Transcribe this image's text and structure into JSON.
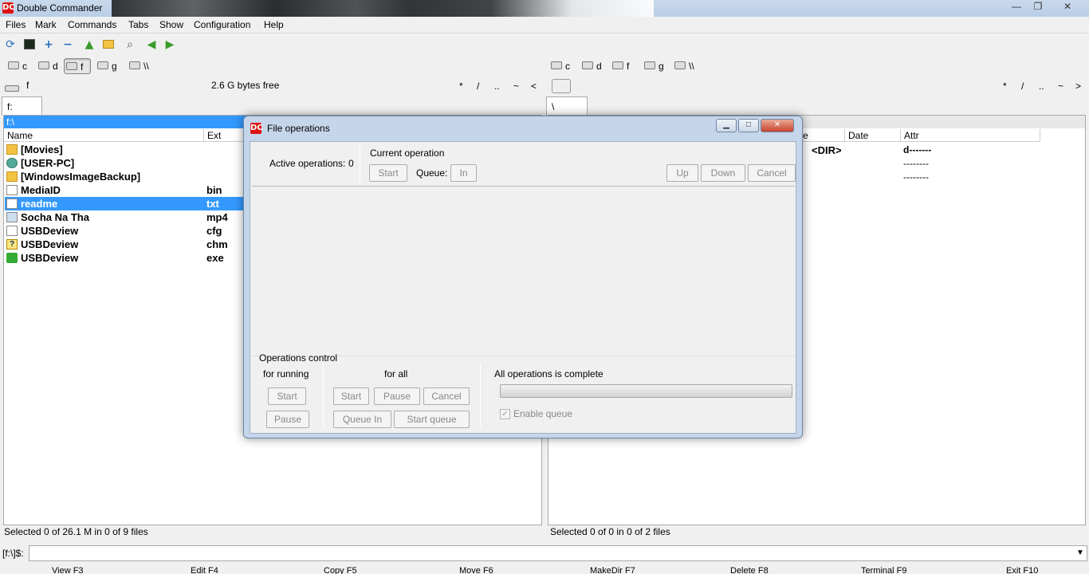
{
  "window": {
    "title": "Double Commander",
    "minimize_label": "—",
    "restore_label": "❐",
    "close_label": "✕"
  },
  "menu": [
    "Files",
    "Mark",
    "Commands",
    "Tabs",
    "Show",
    "Configuration",
    "Help"
  ],
  "toolbar_icons": [
    "refresh-icon",
    "terminal-icon",
    "plus-icon",
    "minus-icon",
    "up-arrow-icon",
    "folder-tree-icon",
    "search-icon",
    "back-arrow-icon",
    "forward-arrow-icon"
  ],
  "left_drives": [
    {
      "label": "c"
    },
    {
      "label": "d"
    },
    {
      "label": "f",
      "active": true
    },
    {
      "label": "g"
    },
    {
      "label": "\\\\"
    }
  ],
  "right_drives": [
    {
      "label": "c"
    },
    {
      "label": "d"
    },
    {
      "label": "f"
    },
    {
      "label": "g"
    },
    {
      "label": "\\\\"
    }
  ],
  "left_panel": {
    "drive": "f",
    "free_space": "2.6 G bytes free",
    "nav": [
      "*",
      "/",
      "..",
      "~",
      "<"
    ],
    "tab": "f:",
    "path": "f:\\",
    "columns": {
      "name": "Name",
      "ext": "Ext"
    },
    "files": [
      {
        "name": "[Movies]",
        "ext": "",
        "icon": "folder-icon"
      },
      {
        "name": "[USER-PC]",
        "ext": "",
        "icon": "network-pc-icon"
      },
      {
        "name": "[WindowsImageBackup]",
        "ext": "",
        "icon": "folder-icon"
      },
      {
        "name": "MediaID",
        "ext": "bin",
        "icon": "document-icon"
      },
      {
        "name": "readme",
        "ext": "txt",
        "icon": "document-icon",
        "selected": true
      },
      {
        "name": "Socha Na Tha",
        "ext": "mp4",
        "icon": "video-icon"
      },
      {
        "name": "USBDeview",
        "ext": "cfg",
        "icon": "document-icon"
      },
      {
        "name": "USBDeview",
        "ext": "chm",
        "icon": "help-file-icon"
      },
      {
        "name": "USBDeview",
        "ext": "exe",
        "icon": "usb-icon"
      }
    ],
    "status": "Selected 0 of 26.1 M in 0 of 9 files"
  },
  "right_panel": {
    "nav": [
      "*",
      "/",
      "..",
      "~",
      ">"
    ],
    "tab": "\\",
    "columns": {
      "size_partial": "e",
      "date": "Date",
      "attr": "Attr"
    },
    "rows": [
      {
        "size": "<DIR>",
        "attr": "d-------"
      },
      {
        "size": "",
        "attr": "--------"
      },
      {
        "size": "",
        "attr": "--------"
      }
    ],
    "status": "Selected 0 of 0 in 0 of 2 files"
  },
  "command_line": {
    "prompt": "[f:\\]$:",
    "value": ""
  },
  "function_keys": [
    "View F3",
    "Edit F4",
    "Copy F5",
    "Move F6",
    "MakeDir F7",
    "Delete F8",
    "Terminal F9",
    "Exit F10"
  ],
  "dialog": {
    "title": "File operations",
    "active_operations_label": "Active operations:",
    "active_operations_count": "0",
    "current_operation_label": "Current operation",
    "start": "Start",
    "queue_label": "Queue:",
    "in": "In",
    "up": "Up",
    "down": "Down",
    "cancel": "Cancel",
    "operations_control_label": "Operations control",
    "for_running_label": "for running",
    "for_all_label": "for all",
    "running_start": "Start",
    "running_pause": "Pause",
    "all_start": "Start",
    "all_pause": "Pause",
    "all_cancel": "Cancel",
    "queue_in": "Queue In",
    "start_queue": "Start queue",
    "status_text": "All operations is complete",
    "progress": 0,
    "enable_queue_label": "Enable queue",
    "enable_queue_checked": true
  }
}
